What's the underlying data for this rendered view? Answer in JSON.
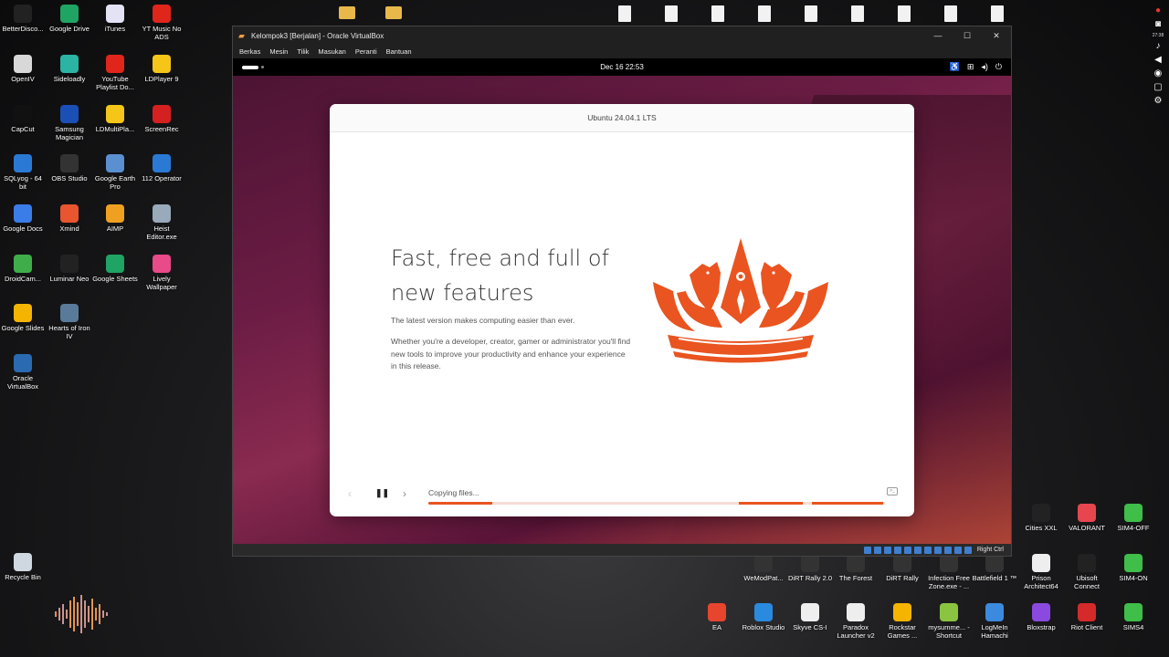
{
  "desktop": {
    "left_icons": [
      {
        "label": "BetterDisco...",
        "icon": "discord-icon",
        "color": "#222"
      },
      {
        "label": "Google Drive",
        "icon": "google-drive-icon",
        "color": "#1fa463"
      },
      {
        "label": "iTunes",
        "icon": "itunes-icon",
        "color": "#e3e3f5"
      },
      {
        "label": "YT Music No ADS",
        "icon": "yt-music-icon",
        "color": "#e0251b"
      },
      {
        "label": "OpenIV",
        "icon": "openiv-icon",
        "color": "#d8d8d8"
      },
      {
        "label": "Sideloadly",
        "icon": "sideloadly-icon",
        "color": "#2bb3a3"
      },
      {
        "label": "YouTube Playlist Do...",
        "icon": "youtube-icon",
        "color": "#e0251b"
      },
      {
        "label": "LDPlayer 9",
        "icon": "ldplayer-icon",
        "color": "#f5c518"
      },
      {
        "label": "CapCut",
        "icon": "capcut-icon",
        "color": "#111"
      },
      {
        "label": "Samsung Magician",
        "icon": "samsung-magician-icon",
        "color": "#1a4fb5"
      },
      {
        "label": "LDMultiPla...",
        "icon": "ldmultiplayer-icon",
        "color": "#f5c518"
      },
      {
        "label": "ScreenRec",
        "icon": "screenrec-icon",
        "color": "#d42020"
      },
      {
        "label": "SQLyog - 64 bit",
        "icon": "sqlyog-icon",
        "color": "#2a7ad5"
      },
      {
        "label": "OBS Studio",
        "icon": "obs-icon",
        "color": "#333"
      },
      {
        "label": "Google Earth Pro",
        "icon": "google-earth-icon",
        "color": "#5a8fd0"
      },
      {
        "label": "112 Operator",
        "icon": "112-operator-icon",
        "color": "#2a7ad5"
      },
      {
        "label": "Google Docs",
        "icon": "google-docs-icon",
        "color": "#3b7de8"
      },
      {
        "label": "Xmind",
        "icon": "xmind-icon",
        "color": "#e8552e"
      },
      {
        "label": "AIMP",
        "icon": "aimp-icon",
        "color": "#f0a020"
      },
      {
        "label": "Heist Editor.exe",
        "icon": "heist-editor-icon",
        "color": "#9ab"
      },
      {
        "label": "DroidCam...",
        "icon": "droidcam-icon",
        "color": "#3fae4a"
      },
      {
        "label": "Luminar Neo",
        "icon": "luminar-icon",
        "color": "#222"
      },
      {
        "label": "Google Sheets",
        "icon": "google-sheets-icon",
        "color": "#1fa463"
      },
      {
        "label": "Lively Wallpaper",
        "icon": "lively-wallpaper-icon",
        "color": "#e84a8a"
      },
      {
        "label": "Google Slides",
        "icon": "google-slides-icon",
        "color": "#f4b400"
      },
      {
        "label": "Hearts of Iron IV",
        "icon": "hearts-of-iron-icon",
        "color": "#5a7a9a"
      },
      {
        "label": "Oracle VirtualBox",
        "icon": "virtualbox-icon",
        "color": "#2a6ab0"
      },
      {
        "label": "Recycle Bin",
        "icon": "recycle-bin-icon",
        "color": "#cfd8e0"
      }
    ],
    "bottom_icons": [
      {
        "label": "Cities XXL",
        "icon": "cities-xxl-icon",
        "color": "#222"
      },
      {
        "label": "VALORANT",
        "icon": "valorant-icon",
        "color": "#e8464f"
      },
      {
        "label": "SIM4-OFF",
        "icon": "sims4-icon",
        "color": "#3fbe4a"
      },
      {
        "label": "WeModPat...",
        "icon": "wemod-icon",
        "color": "#333"
      },
      {
        "label": "DiRT Rally 2.0",
        "icon": "dirt-rally-2-icon",
        "color": "#333"
      },
      {
        "label": "The Forest",
        "icon": "the-forest-icon",
        "color": "#333"
      },
      {
        "label": "DiRT Rally",
        "icon": "dirt-rally-icon",
        "color": "#333"
      },
      {
        "label": "Infection Free Zone.exe - ...",
        "icon": "infection-free-zone-icon",
        "color": "#333"
      },
      {
        "label": "Battlefield 1 ™",
        "icon": "battlefield-icon",
        "color": "#333"
      },
      {
        "label": "Prison Architect64",
        "icon": "prison-architect-icon",
        "color": "#eee"
      },
      {
        "label": "Ubisoft Connect",
        "icon": "ubisoft-icon",
        "color": "#222"
      },
      {
        "label": "SIM4-ON",
        "icon": "sims4-icon",
        "color": "#3fbe4a"
      },
      {
        "label": "EA",
        "icon": "ea-icon",
        "color": "#e8452e"
      },
      {
        "label": "Roblox Studio",
        "icon": "roblox-studio-icon",
        "color": "#2a8ae0"
      },
      {
        "label": "Skyve CS-I",
        "icon": "skyve-icon",
        "color": "#eee"
      },
      {
        "label": "Paradox Launcher v2",
        "icon": "paradox-icon",
        "color": "#eee"
      },
      {
        "label": "Rockstar Games ...",
        "icon": "rockstar-icon",
        "color": "#f5b400"
      },
      {
        "label": "mysumme... - Shortcut",
        "icon": "mysummercar-icon",
        "color": "#8ac440"
      },
      {
        "label": "LogMeIn Hamachi",
        "icon": "hamachi-icon",
        "color": "#3b8ae0"
      },
      {
        "label": "Bloxstrap",
        "icon": "bloxstrap-icon",
        "color": "#8a4ae0"
      },
      {
        "label": "Riot Client",
        "icon": "riot-client-icon",
        "color": "#d42a2a"
      },
      {
        "label": "SIMS4",
        "icon": "sims4-icon",
        "color": "#3fbe4a"
      }
    ]
  },
  "side_bar": {
    "time": "27:38"
  },
  "vbox": {
    "title": "Kelompok3 [Berjalan] - Oracle VirtualBox",
    "menu": [
      "Berkas",
      "Mesin",
      "Tilik",
      "Masukan",
      "Peranti",
      "Bantuan"
    ],
    "host_key": "Right Ctrl"
  },
  "guest": {
    "clock": "Dec 16  22:53",
    "installer": {
      "header": "Ubuntu 24.04.1 LTS",
      "title": "Fast, free and full of new features",
      "p1": "The latest version makes computing easier than ever.",
      "p2": "Whether you're a developer, creator, gamer or administrator you'll find new tools to improve your productivity and enhance your experience in this release.",
      "status": "Copying files...",
      "accent": "#e95420"
    }
  }
}
